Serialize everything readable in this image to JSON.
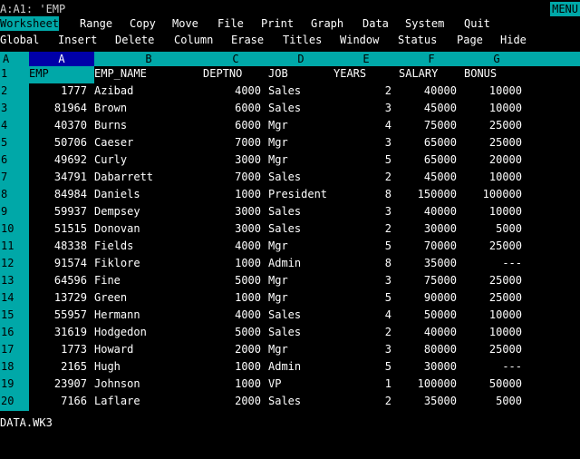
{
  "cell_indicator": "A:A1: 'EMP",
  "mode_indicator": "MENU",
  "menu_main": [
    "Worksheet",
    "Range",
    "Copy",
    "Move",
    "File",
    "Print",
    "Graph",
    "Data",
    "System",
    "Quit"
  ],
  "menu_sub": [
    "Global",
    "Insert",
    "Delete",
    "Column",
    "Erase",
    "Titles",
    "Window",
    "Status",
    "Page",
    "Hide"
  ],
  "sheet_letter": "A",
  "col_headers": [
    "A",
    "B",
    "C",
    "D",
    "E",
    "F",
    "G"
  ],
  "rows": [
    {
      "n": "1",
      "emp": "EMP",
      "name": "EMP_NAME",
      "dept": "DEPTNO",
      "job": "JOB",
      "years": "YEARS",
      "salary": "SALARY",
      "bonus": "BONUS"
    },
    {
      "n": "2",
      "emp": "1777",
      "name": "Azibad",
      "dept": "4000",
      "job": "Sales",
      "years": "2",
      "salary": "40000",
      "bonus": "10000"
    },
    {
      "n": "3",
      "emp": "81964",
      "name": "Brown",
      "dept": "6000",
      "job": "Sales",
      "years": "3",
      "salary": "45000",
      "bonus": "10000"
    },
    {
      "n": "4",
      "emp": "40370",
      "name": "Burns",
      "dept": "6000",
      "job": "Mgr",
      "years": "4",
      "salary": "75000",
      "bonus": "25000"
    },
    {
      "n": "5",
      "emp": "50706",
      "name": "Caeser",
      "dept": "7000",
      "job": "Mgr",
      "years": "3",
      "salary": "65000",
      "bonus": "25000"
    },
    {
      "n": "6",
      "emp": "49692",
      "name": "Curly",
      "dept": "3000",
      "job": "Mgr",
      "years": "5",
      "salary": "65000",
      "bonus": "20000"
    },
    {
      "n": "7",
      "emp": "34791",
      "name": "Dabarrett",
      "dept": "7000",
      "job": "Sales",
      "years": "2",
      "salary": "45000",
      "bonus": "10000"
    },
    {
      "n": "8",
      "emp": "84984",
      "name": "Daniels",
      "dept": "1000",
      "job": "President",
      "years": "8",
      "salary": "150000",
      "bonus": "100000"
    },
    {
      "n": "9",
      "emp": "59937",
      "name": "Dempsey",
      "dept": "3000",
      "job": "Sales",
      "years": "3",
      "salary": "40000",
      "bonus": "10000"
    },
    {
      "n": "10",
      "emp": "51515",
      "name": "Donovan",
      "dept": "3000",
      "job": "Sales",
      "years": "2",
      "salary": "30000",
      "bonus": "5000"
    },
    {
      "n": "11",
      "emp": "48338",
      "name": "Fields",
      "dept": "4000",
      "job": "Mgr",
      "years": "5",
      "salary": "70000",
      "bonus": "25000"
    },
    {
      "n": "12",
      "emp": "91574",
      "name": "Fiklore",
      "dept": "1000",
      "job": "Admin",
      "years": "8",
      "salary": "35000",
      "bonus": "---"
    },
    {
      "n": "13",
      "emp": "64596",
      "name": "Fine",
      "dept": "5000",
      "job": "Mgr",
      "years": "3",
      "salary": "75000",
      "bonus": "25000"
    },
    {
      "n": "14",
      "emp": "13729",
      "name": "Green",
      "dept": "1000",
      "job": "Mgr",
      "years": "5",
      "salary": "90000",
      "bonus": "25000"
    },
    {
      "n": "15",
      "emp": "55957",
      "name": "Hermann",
      "dept": "4000",
      "job": "Sales",
      "years": "4",
      "salary": "50000",
      "bonus": "10000"
    },
    {
      "n": "16",
      "emp": "31619",
      "name": "Hodgedon",
      "dept": "5000",
      "job": "Sales",
      "years": "2",
      "salary": "40000",
      "bonus": "10000"
    },
    {
      "n": "17",
      "emp": "1773",
      "name": "Howard",
      "dept": "2000",
      "job": "Mgr",
      "years": "3",
      "salary": "80000",
      "bonus": "25000"
    },
    {
      "n": "18",
      "emp": "2165",
      "name": "Hugh",
      "dept": "1000",
      "job": "Admin",
      "years": "5",
      "salary": "30000",
      "bonus": "---"
    },
    {
      "n": "19",
      "emp": "23907",
      "name": "Johnson",
      "dept": "1000",
      "job": "VP",
      "years": "1",
      "salary": "100000",
      "bonus": "50000"
    },
    {
      "n": "20",
      "emp": "7166",
      "name": "Laflare",
      "dept": "2000",
      "job": "Sales",
      "years": "2",
      "salary": "35000",
      "bonus": "5000"
    }
  ],
  "status_file": "DATA.WK3",
  "colors": {
    "menu_highlight": "#00a8a8",
    "cursor": "#0000a8",
    "background": "#000000"
  }
}
